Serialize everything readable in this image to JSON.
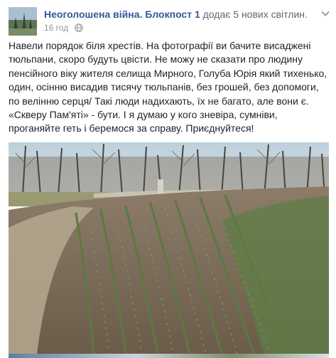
{
  "post": {
    "author": "Неоголошена війна. Блокпост 1",
    "action": "додає 5 нових світлин.",
    "time": "16 год",
    "privacy_icon": "globe-icon",
    "menu_icon": "chevron-down-icon",
    "text": "Навели порядок біля хрестів. На фотографії ви бачите висаджені тюльпани, скоро будуть цвісти. Не можу не сказати про людину пенсійного віку жителя селища Мирного, Голуба Юрія який тихенько, один, осінню висадив тисячу тюльпанів, без грошей, без допомоги, по велінню серця/ Такі люди надихають, їх не багато, але вони є. «Скверу Пам'яті» - бути. І я думаю у кого зневіра, сумніви, проганяйте геть і беремося за справу. Приєднуйтеся!"
  },
  "colors": {
    "link": "#365899",
    "secondary": "#616770",
    "meta": "#90949c",
    "text": "#1d2129"
  }
}
